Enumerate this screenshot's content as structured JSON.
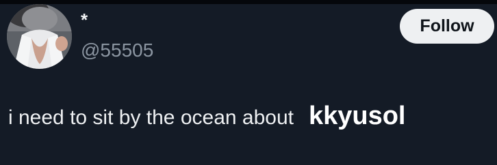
{
  "user": {
    "display_name": "*",
    "handle": "@55505",
    "avatar_icon": "profile-photo"
  },
  "actions": {
    "follow_label": "Follow"
  },
  "tweet": {
    "text": "i need to sit by the ocean about",
    "name_overlay": "kkyusol"
  },
  "colors": {
    "background": "#141b26",
    "follow_button_bg": "#eef0f2",
    "handle_text": "#8b95a1"
  }
}
